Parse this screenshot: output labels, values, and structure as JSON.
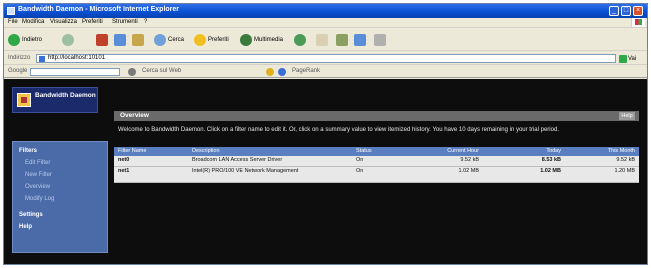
{
  "window": {
    "title": "Bandwidth Daemon - Microsoft Internet Explorer",
    "buttons": [
      "_",
      "□",
      "×"
    ]
  },
  "menu": [
    "File",
    "Modifica",
    "Visualizza",
    "Preferiti",
    "Strumenti",
    "?"
  ],
  "toolbar": {
    "back_label": "Indietro",
    "search_label": "Cerca",
    "favorites_label": "Preferiti",
    "media_label": "Multimedia"
  },
  "address": {
    "label": "Indirizzo",
    "url": "http://localhost:10101",
    "go_label": "Vai"
  },
  "links": {
    "label": "Google",
    "search_label": "Cerca sul Web",
    "pagerank_label": "PageRank"
  },
  "app": {
    "name": "Bandwidth Daemon",
    "section_title": "Overview",
    "help_label": "Help",
    "intro": "Welcome to Bandwidth Daemon. Click on a filter name to edit it. Or, click on a summary value to view itemized history. You have 10 days remaining in your trial period."
  },
  "sidebar": {
    "items": [
      {
        "label": "Filters",
        "kind": "head"
      },
      {
        "label": "Edit Filter",
        "kind": "sub"
      },
      {
        "label": "New Filter",
        "kind": "sub"
      },
      {
        "label": "Overview",
        "kind": "sub"
      },
      {
        "label": "Modify Log",
        "kind": "sub"
      },
      {
        "label": "Settings",
        "kind": "head"
      },
      {
        "label": "Help",
        "kind": "head"
      }
    ]
  },
  "table": {
    "columns": [
      "Filter Name",
      "Description",
      "Status",
      "Current Hour",
      "Today",
      "This Month"
    ],
    "rows": [
      {
        "name": "net0",
        "description": "Broadcom LAN Access Server Driver",
        "status": "On",
        "hour": "9.52 kB",
        "today": "8.53 kB",
        "month": "9.52 kB"
      },
      {
        "name": "net1",
        "description": "Intel(R) PRO/100 VE Network Management",
        "status": "On",
        "hour": "1.02 MB",
        "today": "1.02 MB",
        "month": "1.20 MB"
      }
    ]
  },
  "colors": {
    "titlebar": "#0a4fd0",
    "page_bg": "#0d0d0d",
    "sidebar": "#4a6ba8",
    "grid_header": "#5a7fc0"
  }
}
